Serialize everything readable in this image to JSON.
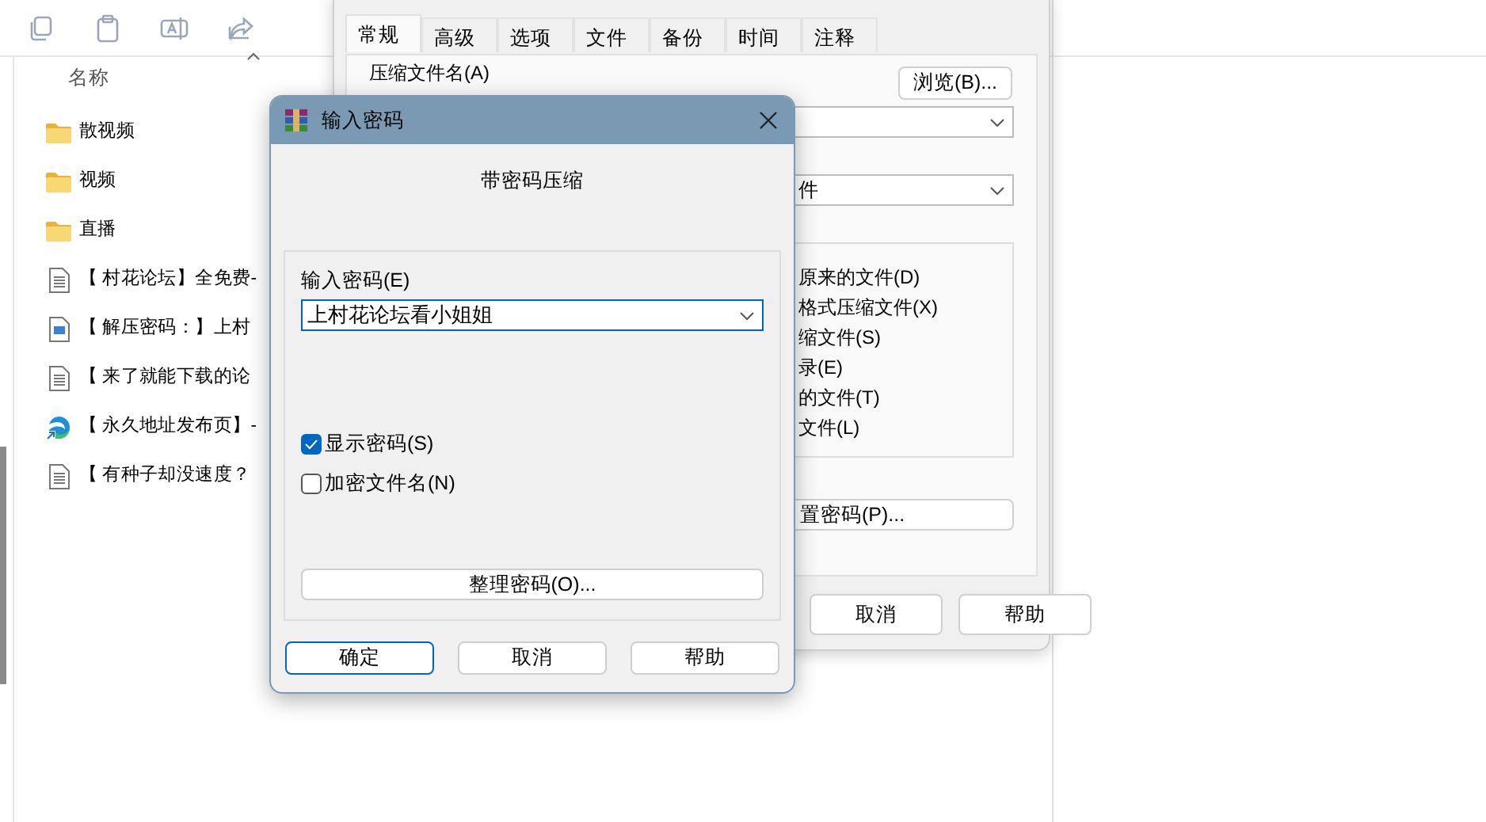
{
  "explorer": {
    "column_header": "名称",
    "files": [
      {
        "name": "散视频",
        "kind": "folder"
      },
      {
        "name": "视频",
        "kind": "folder"
      },
      {
        "name": "直播",
        "kind": "folder"
      },
      {
        "name": "【 村花论坛】全免费-",
        "kind": "document"
      },
      {
        "name": "【 解压密码：】上村",
        "kind": "image"
      },
      {
        "name": "【 来了就能下载的论",
        "kind": "document"
      },
      {
        "name": "【 永久地址发布页】-",
        "kind": "web"
      },
      {
        "name": "【 有种子却没速度？",
        "kind": "document"
      }
    ]
  },
  "archive_dialog": {
    "tabs": [
      {
        "label": "常规",
        "selected": true
      },
      {
        "label": "高级",
        "selected": false
      },
      {
        "label": "选项",
        "selected": false
      },
      {
        "label": "文件",
        "selected": false
      },
      {
        "label": "备份",
        "selected": false
      },
      {
        "label": "时间",
        "selected": false
      },
      {
        "label": "注释",
        "selected": false
      }
    ],
    "filename_label": "压缩文件名(A)",
    "browse_button": "浏览(B)...",
    "format_dropdown": "件",
    "options": [
      "原来的文件(D)",
      "格式压缩文件(X)",
      "缩文件(S)",
      "录(E)",
      "的文件(T)",
      "文件(L)"
    ],
    "set_password_button": "置密码(P)...",
    "buttons": [
      "取消",
      "帮助"
    ]
  },
  "password_dialog": {
    "title": "输入密码",
    "heading": "带密码压缩",
    "password_label": "输入密码(E)",
    "password_value": "上村花论坛看小姐姐",
    "checkboxes": [
      {
        "label": "显示密码(S)",
        "checked": true
      },
      {
        "label": "加密文件名(N)",
        "checked": false
      }
    ],
    "organize_button": "整理密码(O)...",
    "buttons": [
      {
        "label": "确定",
        "default": true
      },
      {
        "label": "取消",
        "default": false
      },
      {
        "label": "帮助",
        "default": false
      }
    ]
  }
}
